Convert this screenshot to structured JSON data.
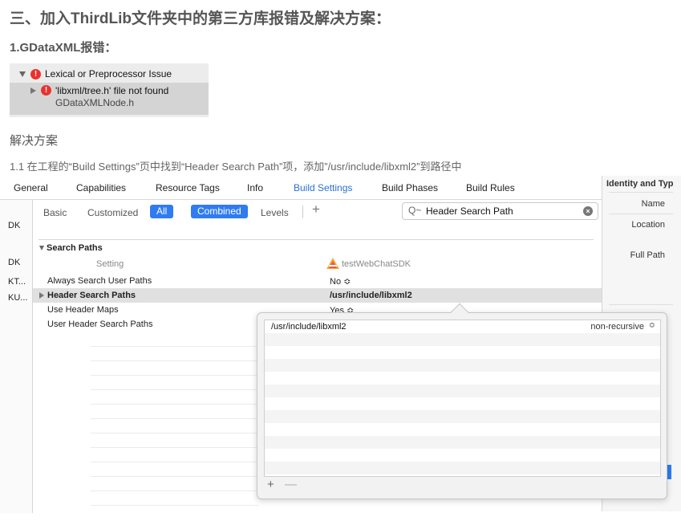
{
  "article": {
    "section_heading": "三、加入ThirdLib文件夹中的第三方库报错及解决方案：",
    "sub_heading": "1.GDataXML报错：",
    "solution_heading": "解决方案",
    "step_text": "1.1 在工程的“Build Settings”页中找到“Header Search Path”项，添加”/usr/include/libxml2”到路径中"
  },
  "issue_navigator": {
    "group_label": "Lexical or Preprocessor Issue",
    "error_message": "'libxml/tree.h' file not found",
    "error_file": "GDataXMLNode.h",
    "error_glyph": "!"
  },
  "xcode": {
    "tabs": [
      {
        "label": "General"
      },
      {
        "label": "Capabilities"
      },
      {
        "label": "Resource Tags"
      },
      {
        "label": "Info"
      },
      {
        "label": "Build Settings"
      },
      {
        "label": "Build Phases"
      },
      {
        "label": "Build Rules"
      }
    ],
    "left_nav": [
      "DK",
      "DK",
      "KT...",
      "KU..."
    ],
    "filter": {
      "basic": "Basic",
      "customized": "Customized",
      "all": "All",
      "combined": "Combined",
      "levels": "Levels",
      "add": "+"
    },
    "search": {
      "value": "Header Search Path",
      "icon": "Q~",
      "clear": "×"
    },
    "section_title": "Search Paths",
    "column_setting": "Setting",
    "target_name": "testWebChatSDK",
    "rows": [
      {
        "name": "Always Search User Paths",
        "value": "No ≎"
      },
      {
        "name": "Header Search Paths",
        "value": "/usr/include/libxml2"
      },
      {
        "name": "Use Header Maps",
        "value": "Yes ≎"
      },
      {
        "name": "User Header Search Paths",
        "value": ""
      }
    ],
    "inspector": {
      "title": "Identity and Typ",
      "name_label": "Name",
      "location_label": "Location",
      "full_path_label": "Full Path"
    },
    "popover": {
      "path": "/usr/include/libxml2",
      "mode": "non-recursive",
      "mode_chevron": "≎",
      "add": "+",
      "remove": "—"
    }
  }
}
